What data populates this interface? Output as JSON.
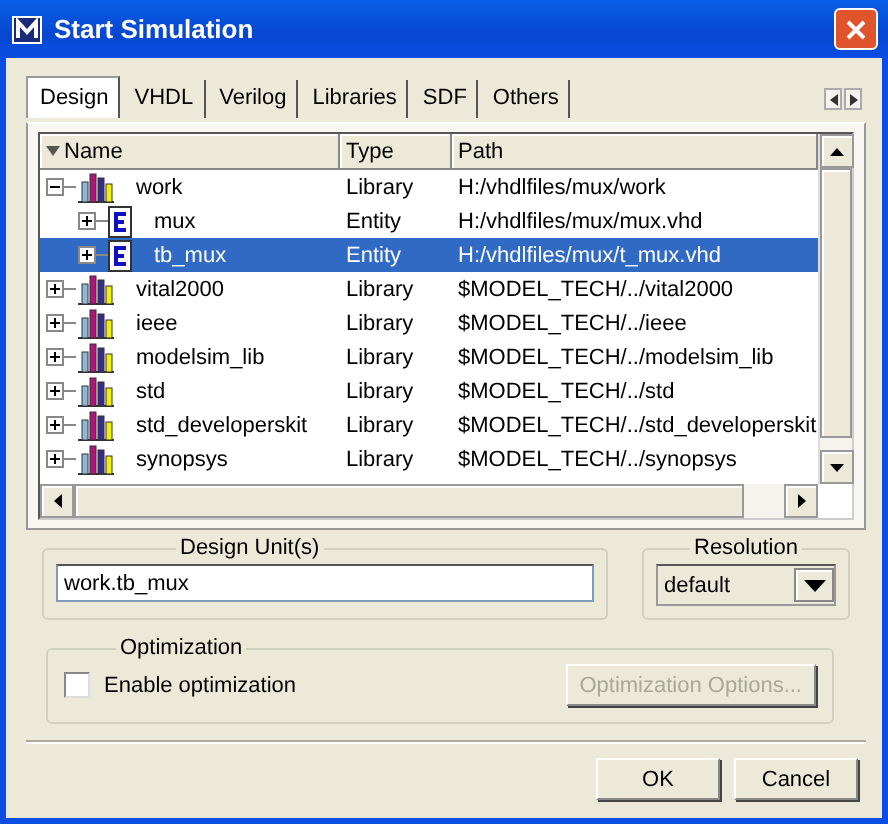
{
  "window": {
    "title": "Start Simulation"
  },
  "tabs": [
    {
      "label": "Design",
      "selected": true
    },
    {
      "label": "VHDL",
      "selected": false
    },
    {
      "label": "Verilog",
      "selected": false
    },
    {
      "label": "Libraries",
      "selected": false
    },
    {
      "label": "SDF",
      "selected": false
    },
    {
      "label": "Others",
      "selected": false
    }
  ],
  "tree": {
    "columns": [
      "Name",
      "Type",
      "Path"
    ],
    "rows": [
      {
        "kind": "library",
        "name": "work",
        "type": "Library",
        "path": "H:/vhdlfiles/mux/work",
        "expanded": true,
        "selected": false,
        "children": [
          {
            "kind": "entity",
            "name": "mux",
            "type": "Entity",
            "path": "H:/vhdlfiles/mux/mux.vhd",
            "expanded": false,
            "selected": false
          },
          {
            "kind": "entity",
            "name": "tb_mux",
            "type": "Entity",
            "path": "H:/vhdlfiles/mux/t_mux.vhd",
            "expanded": false,
            "selected": true
          }
        ]
      },
      {
        "kind": "library",
        "name": "vital2000",
        "type": "Library",
        "path": "$MODEL_TECH/../vital2000",
        "expanded": false,
        "selected": false
      },
      {
        "kind": "library",
        "name": "ieee",
        "type": "Library",
        "path": "$MODEL_TECH/../ieee",
        "expanded": false,
        "selected": false
      },
      {
        "kind": "library",
        "name": "modelsim_lib",
        "type": "Library",
        "path": "$MODEL_TECH/../modelsim_lib",
        "expanded": false,
        "selected": false
      },
      {
        "kind": "library",
        "name": "std",
        "type": "Library",
        "path": "$MODEL_TECH/../std",
        "expanded": false,
        "selected": false
      },
      {
        "kind": "library",
        "name": "std_developerskit",
        "type": "Library",
        "path": "$MODEL_TECH/../std_developerskit",
        "expanded": false,
        "selected": false
      },
      {
        "kind": "library",
        "name": "synopsys",
        "type": "Library",
        "path": "$MODEL_TECH/../synopsys",
        "expanded": false,
        "selected": false
      }
    ]
  },
  "design_units": {
    "label": "Design Unit(s)",
    "value": "work.tb_mux"
  },
  "resolution": {
    "label": "Resolution",
    "value": "default"
  },
  "optimization": {
    "label": "Optimization",
    "checkbox": {
      "label": "Enable optimization",
      "checked": false
    },
    "options_button": {
      "label": "Optimization Options...",
      "disabled": true
    }
  },
  "buttons": [
    "OK",
    "Cancel"
  ]
}
